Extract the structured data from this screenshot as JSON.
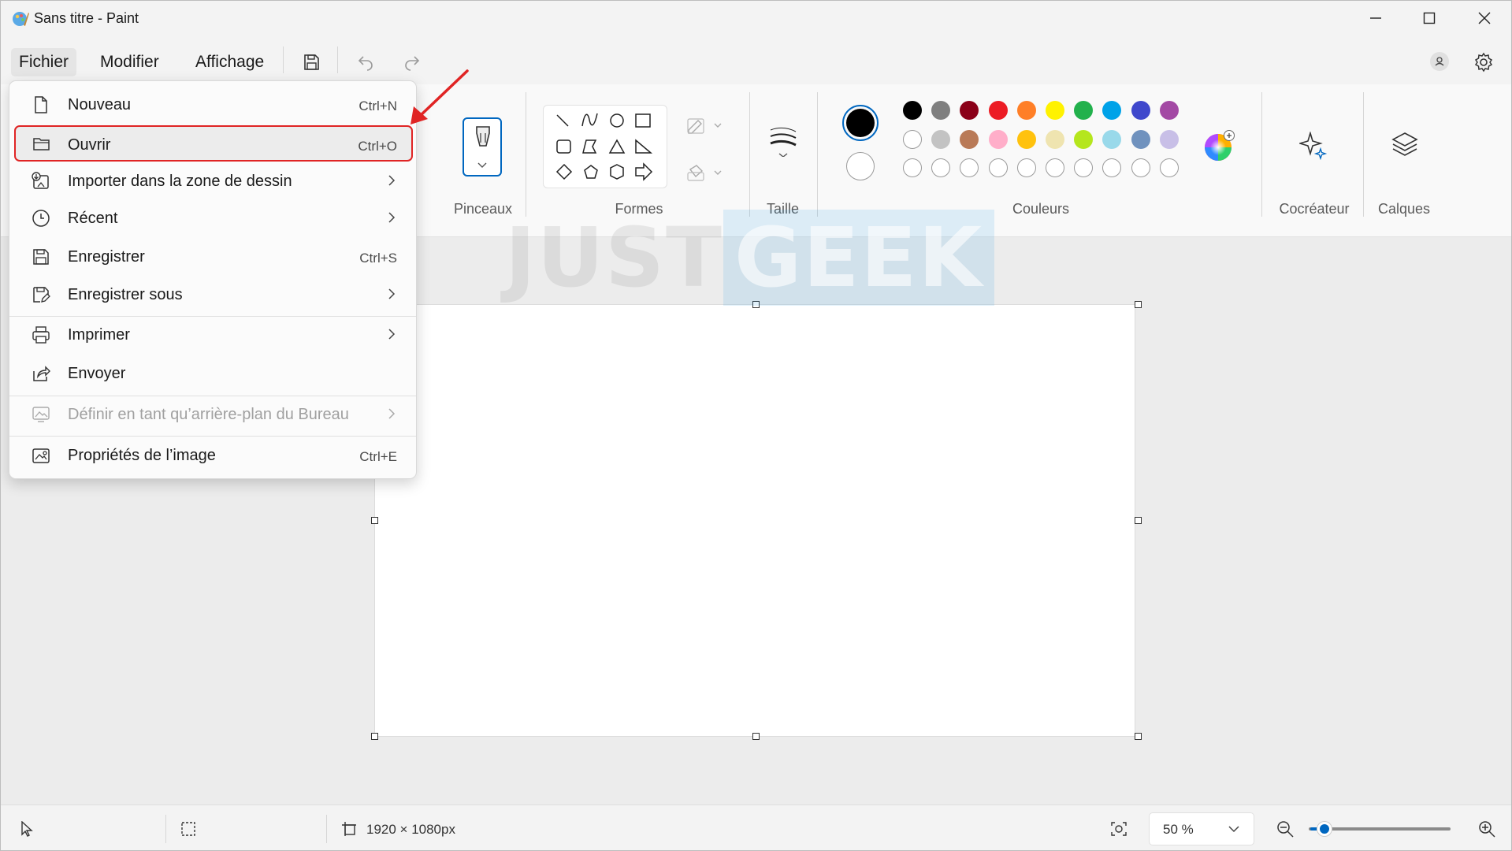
{
  "window": {
    "title": "Sans titre - Paint"
  },
  "menubar": {
    "items": [
      {
        "label": "Fichier"
      },
      {
        "label": "Modifier"
      },
      {
        "label": "Affichage"
      }
    ]
  },
  "ribbon": {
    "groups": {
      "brushes": "Pinceaux",
      "shapes": "Formes",
      "size": "Taille",
      "colors": "Couleurs",
      "cocreator": "Cocréateur",
      "layers": "Calques"
    },
    "palette_row1": [
      "#000000",
      "#7f7f7f",
      "#8b0018",
      "#ec1c24",
      "#ff7f27",
      "#fff200",
      "#22b14c",
      "#00a2e8",
      "#3f48cc",
      "#a349a4"
    ],
    "palette_row2": [
      "#ffffff",
      "#c3c3c3",
      "#b97a57",
      "#ffaec9",
      "#ffc20e",
      "#efe4b0",
      "#b5e61d",
      "#99d9ea",
      "#7092be",
      "#c8bfe7"
    ],
    "primary_color": "#000000",
    "secondary_color": "#ffffff"
  },
  "watermark": {
    "part1": "JUST",
    "part2": "GEEK"
  },
  "file_menu": {
    "items": [
      {
        "label": "Nouveau",
        "shortcut": "Ctrl+N"
      },
      {
        "label": "Ouvrir",
        "shortcut": "Ctrl+O"
      },
      {
        "label": "Importer dans la zone de dessin"
      },
      {
        "label": "Récent"
      },
      {
        "label": "Enregistrer",
        "shortcut": "Ctrl+S"
      },
      {
        "label": "Enregistrer sous"
      },
      {
        "label": "Imprimer"
      },
      {
        "label": "Envoyer"
      },
      {
        "label": "Définir en tant qu’arrière-plan du Bureau"
      },
      {
        "label": "Propriétés de l’image",
        "shortcut": "Ctrl+E"
      }
    ]
  },
  "statusbar": {
    "canvas_size": "1920 × 1080px",
    "zoom": "50 %"
  },
  "colors": {
    "accent": "#0067c0",
    "highlight_border": "#e02424",
    "arrow": "#e02424"
  }
}
